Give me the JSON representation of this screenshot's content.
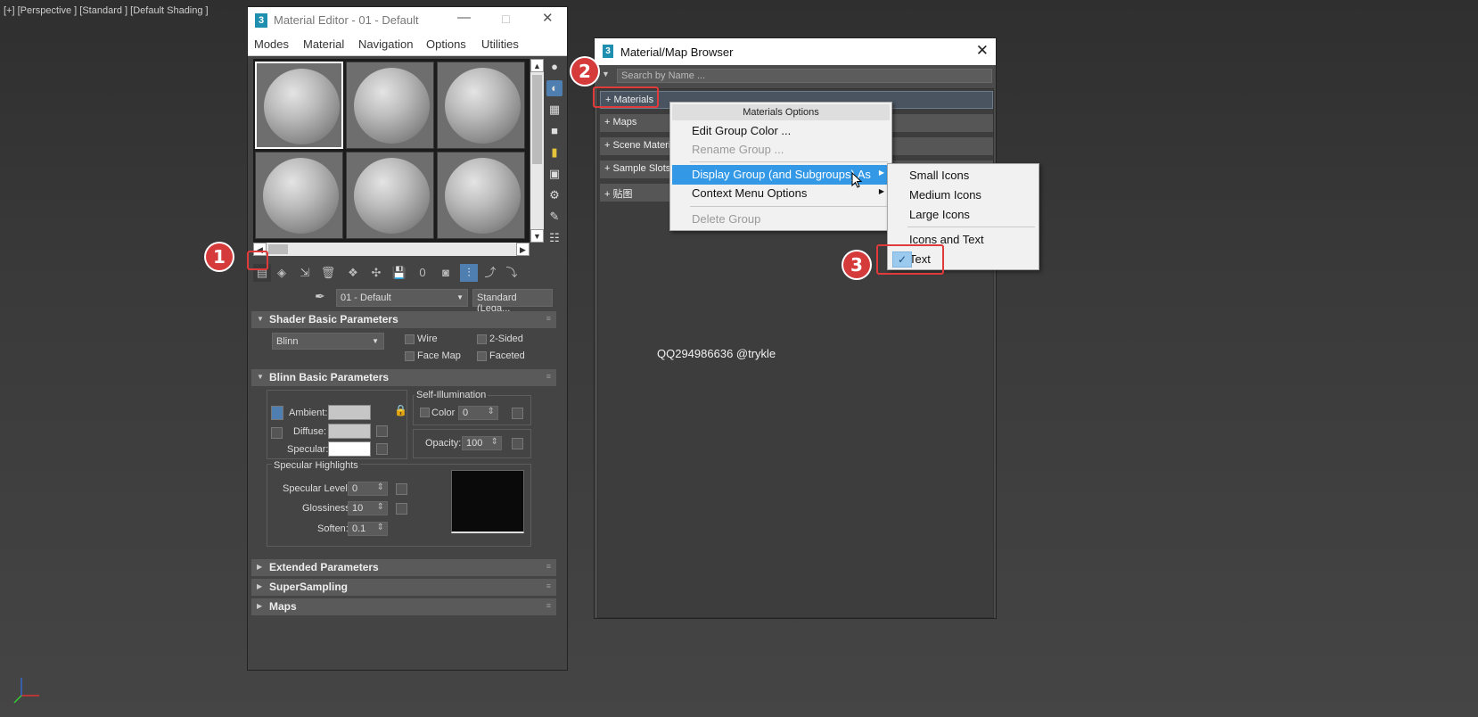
{
  "viewport": {
    "label": "[+] [Perspective ] [Standard ] [Default Shading ]"
  },
  "material_editor": {
    "title": "Material Editor - 01 - Default",
    "window_controls": [
      "—",
      "☐",
      "✕"
    ],
    "menu": [
      "Modes",
      "Material",
      "Navigation",
      "Options",
      "Utilities"
    ],
    "material_name": "01 - Default",
    "material_type": "Standard (Lega...",
    "shader": {
      "header": "Shader Basic Parameters",
      "type": "Blinn",
      "wire": "Wire",
      "two_sided": "2-Sided",
      "face_map": "Face Map",
      "faceted": "Faceted"
    },
    "blinn": {
      "header": "Blinn Basic Parameters",
      "ambient": "Ambient:",
      "diffuse": "Diffuse:",
      "specular": "Specular:",
      "self_illum": "Self-Illumination",
      "color": "Color",
      "color_value": "0",
      "opacity": "Opacity:",
      "opacity_value": "100",
      "spec_highlights": "Specular Highlights",
      "spec_level": "Specular Level:",
      "spec_level_value": "0",
      "glossiness": "Glossiness:",
      "glossiness_value": "10",
      "soften": "Soften:",
      "soften_value": "0.1",
      "ambient_color": "#c6c6c6",
      "diffuse_color": "#c6c6c6",
      "specular_color": "#ffffff"
    },
    "extended": "Extended Parameters",
    "supersampling": "SuperSampling",
    "maps": "Maps"
  },
  "browser": {
    "title": "Material/Map Browser",
    "close": "✕",
    "search_placeholder": "Search by Name ...",
    "groups": [
      "+ Materials",
      "+ Maps",
      "+ Scene Materials",
      "+ Sample Slots",
      "+ 贴图"
    ]
  },
  "context_menu": {
    "header": "Materials Options",
    "items": [
      "Edit Group Color ...",
      "Rename Group ...",
      "Display Group (and Subgroups) As",
      "Context Menu Options",
      "Delete Group"
    ]
  },
  "submenu": {
    "items": [
      "Small Icons",
      "Medium Icons",
      "Large Icons",
      "Icons and Text",
      "Text"
    ],
    "checked": "Text",
    "check_mark": "✓"
  },
  "annotations": [
    "1",
    "2",
    "3"
  ],
  "watermark": "QQ294986636 @trykle",
  "colors": {
    "highlight": "#3399e6",
    "annotation_red": "#d63b3b",
    "check_bg": "#9cc9ee"
  }
}
